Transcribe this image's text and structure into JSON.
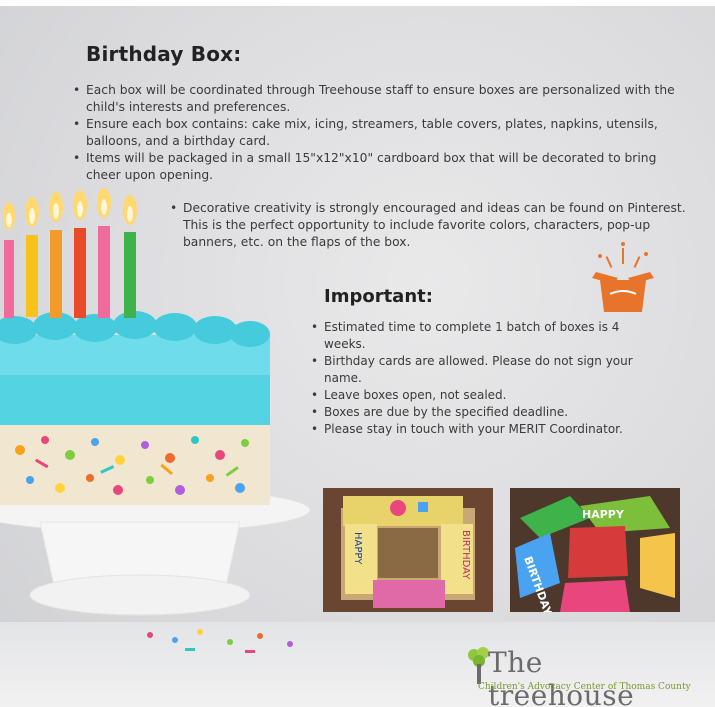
{
  "title": "Birthday Box:",
  "main_bullets": [
    "Each box will be coordinated through Treehouse staff to ensure boxes are personalized with the child's interests and preferences.",
    "Ensure each box contains: cake mix, icing, streamers, table covers, plates, napkins, utensils, balloons, and a birthday card.",
    "Items will be packaged in a small 15\"x12\"x10\" cardboard box that will be decorated to bring cheer upon opening."
  ],
  "sub_bullets": [
    "Decorative creativity is strongly encouraged and ideas can be found on Pinterest. This is the perfect opportunity to include favorite colors, characters, pop-up banners, etc. on the flaps of the box."
  ],
  "important": {
    "heading": "Important:",
    "items": [
      "Estimated time to complete 1 batch of boxes is 4 weeks.",
      "Birthday cards are allowed. Please do not sign your name.",
      "Leave boxes open, not sealed.",
      "Boxes are due by the specified deadline.",
      "Please stay in touch with your MERIT Coordinator."
    ]
  },
  "photo1_flaps": [
    "HAPPY",
    "BIRTHDAY"
  ],
  "photo2_flaps": [
    "HAPPY",
    "BIRTHDAY"
  ],
  "logo": {
    "name": "The treehouse",
    "tagline": "Children's Advocacy Center of Thomas County"
  },
  "colors": {
    "accent_orange": "#e8742c",
    "frosting": "#4fd3e3",
    "logo_green": "#8dc63f"
  }
}
